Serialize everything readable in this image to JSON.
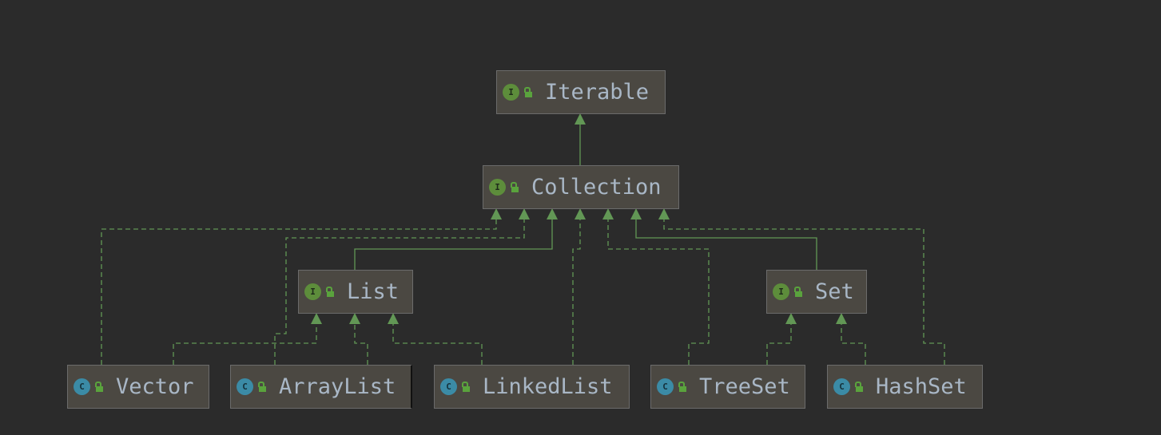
{
  "colors": {
    "background": "#2b2b2b",
    "node_fill": "#4b4842",
    "node_border": "#6b6b6b",
    "edge": "#629755",
    "text": "#a9b7c6",
    "interface_icon": "#5d8d3b",
    "class_icon": "#3b8ba6"
  },
  "nodes": [
    {
      "id": "Iterable",
      "label": "Iterable",
      "kind": "interface",
      "icon": "I"
    },
    {
      "id": "Collection",
      "label": "Collection",
      "kind": "interface",
      "icon": "I"
    },
    {
      "id": "List",
      "label": "List",
      "kind": "interface",
      "icon": "I"
    },
    {
      "id": "Set",
      "label": "Set",
      "kind": "interface",
      "icon": "I"
    },
    {
      "id": "Vector",
      "label": "Vector",
      "kind": "class",
      "icon": "C"
    },
    {
      "id": "ArrayList",
      "label": "ArrayList",
      "kind": "class",
      "icon": "C"
    },
    {
      "id": "LinkedList",
      "label": "LinkedList",
      "kind": "class",
      "icon": "C"
    },
    {
      "id": "TreeSet",
      "label": "TreeSet",
      "kind": "class",
      "icon": "C"
    },
    {
      "id": "HashSet",
      "label": "HashSet",
      "kind": "class",
      "icon": "C"
    }
  ],
  "edges": [
    {
      "from": "Collection",
      "to": "Iterable",
      "type": "extends"
    },
    {
      "from": "Vector",
      "to": "Collection",
      "type": "implements"
    },
    {
      "from": "ArrayList",
      "to": "Collection",
      "type": "implements"
    },
    {
      "from": "List",
      "to": "Collection",
      "type": "extends"
    },
    {
      "from": "LinkedList",
      "to": "Collection",
      "type": "implements"
    },
    {
      "from": "TreeSet",
      "to": "Collection",
      "type": "implements"
    },
    {
      "from": "Set",
      "to": "Collection",
      "type": "extends"
    },
    {
      "from": "HashSet",
      "to": "Collection",
      "type": "implements"
    },
    {
      "from": "Vector",
      "to": "List",
      "type": "implements"
    },
    {
      "from": "ArrayList",
      "to": "List",
      "type": "implements"
    },
    {
      "from": "LinkedList",
      "to": "List",
      "type": "implements"
    },
    {
      "from": "TreeSet",
      "to": "Set",
      "type": "implements"
    },
    {
      "from": "HashSet",
      "to": "Set",
      "type": "implements"
    }
  ]
}
